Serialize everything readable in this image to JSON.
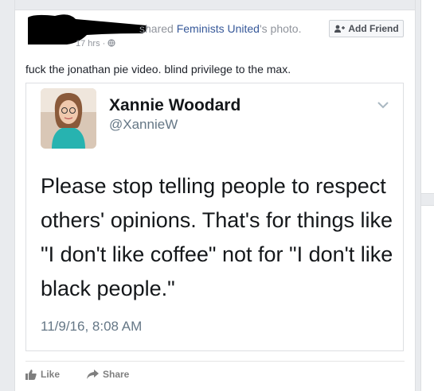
{
  "post": {
    "shared_prefix": "shared",
    "page_name": "Feminists United",
    "shared_suffix": "'s photo.",
    "time": "17 hrs ·",
    "add_friend_label": "Add Friend",
    "text": "fuck the jonathan pie video. blind privilege to the max."
  },
  "tweet": {
    "name": "Xannie Woodard",
    "handle": "@XannieW",
    "body": "Please stop telling people to respect others' opinions. That's for things like \"I don't like coffee\" not for \"I don't like black people.\"",
    "date": "11/9/16, 8:08 AM"
  },
  "actions": {
    "like_label": "Like",
    "share_label": "Share"
  },
  "icons": [
    "globe-icon",
    "add-friend-icon",
    "chevron-down-icon",
    "like-icon",
    "share-icon"
  ],
  "colors": {
    "link": "#365899",
    "muted": "#90949c",
    "text": "#1d2129"
  }
}
